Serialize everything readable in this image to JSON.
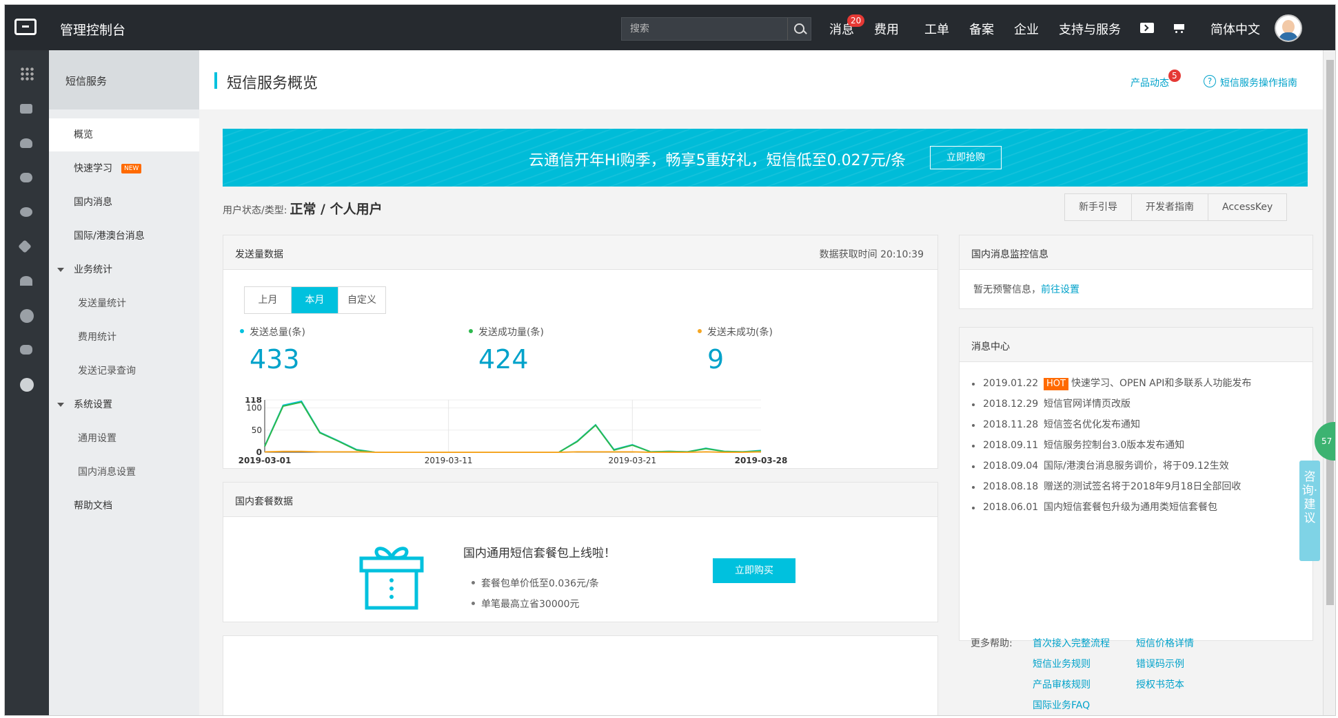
{
  "topbar": {
    "console_title": "管理控制台",
    "search_placeholder": "搜索",
    "nav": [
      "消息",
      "费用",
      "工单",
      "备案",
      "企业",
      "支持与服务"
    ],
    "message_count": "20",
    "language": "简体中文"
  },
  "subnav": {
    "header": "短信服务",
    "items": [
      "概览",
      "快速学习",
      "国内消息",
      "国际/港澳台消息",
      "业务统计",
      "发送量统计",
      "费用统计",
      "发送记录查询",
      "系统设置",
      "通用设置",
      "国内消息设置",
      "帮助文档"
    ],
    "new_badge": "NEW"
  },
  "page": {
    "title": "短信服务概览",
    "product_news": "产品动态",
    "product_news_count": "5",
    "guide_link": "短信服务操作指南",
    "help_mark": "?"
  },
  "banner": {
    "text": "云通信开年Hi购季，畅享5重好礼，短信低至0.027元/条",
    "button": "立即抢购"
  },
  "user_status": {
    "label": "用户状态/类型:",
    "value": "正常 / 个人用户"
  },
  "quick_buttons": [
    "新手引导",
    "开发者指南",
    "AccessKey"
  ],
  "send_card": {
    "title": "发送量数据",
    "fetch_time": "数据获取时间 20:10:39",
    "tabs": [
      "上月",
      "本月",
      "自定义"
    ],
    "active_tab": "本月",
    "stats": [
      {
        "label": "发送总量(条)",
        "value": "433",
        "color": "#00c1de"
      },
      {
        "label": "发送成功量(条)",
        "value": "424",
        "color": "#2db84d"
      },
      {
        "label": "发送未成功(条)",
        "value": "9",
        "color": "#f5a623"
      }
    ]
  },
  "chart_data": {
    "type": "line",
    "x_labels": [
      "2019-03-01",
      "2019-03-11",
      "2019-03-21",
      "2019-03-28"
    ],
    "x": [
      1,
      2,
      3,
      4,
      5,
      6,
      7,
      8,
      9,
      10,
      11,
      12,
      13,
      14,
      15,
      16,
      17,
      18,
      19,
      20,
      21,
      22,
      23,
      24,
      25,
      26,
      27,
      28
    ],
    "ylim": [
      0,
      118
    ],
    "yticks": [
      0,
      50,
      100,
      118
    ],
    "series": [
      {
        "color": "#00c1de",
        "values": [
          14,
          106,
          115,
          45,
          26,
          6,
          0,
          0,
          0,
          0,
          0,
          0,
          0,
          0,
          0,
          0,
          0,
          25,
          62,
          6,
          17,
          1,
          2,
          1,
          9,
          2,
          1,
          4
        ]
      },
      {
        "color": "#2db84d",
        "values": [
          13,
          104,
          113,
          44,
          25,
          5,
          0,
          0,
          0,
          0,
          0,
          0,
          0,
          0,
          0,
          0,
          0,
          24,
          61,
          5,
          16,
          1,
          2,
          1,
          8,
          2,
          1,
          3
        ]
      },
      {
        "color": "#f5a623",
        "values": [
          1,
          2,
          2,
          1,
          1,
          1,
          0,
          0,
          0,
          0,
          0,
          0,
          0,
          0,
          0,
          0,
          0,
          1,
          1,
          1,
          1,
          0,
          0,
          0,
          1,
          0,
          0,
          1
        ]
      }
    ]
  },
  "package_card": {
    "title": "国内套餐数据",
    "headline": "国内通用短信套餐包上线啦！",
    "points": [
      "套餐包单价低至0.036元/条",
      "单笔最高立省30000元"
    ],
    "button": "立即购买"
  },
  "monitor_card": {
    "title": "国内消息监控信息",
    "text": "暂无预警信息，",
    "link": "前往设置"
  },
  "message_center": {
    "title": "消息中心",
    "hot_label": "HOT",
    "items": [
      {
        "date": "2019.01.22",
        "text": "快速学习、OPEN API和多联系人功能发布"
      },
      {
        "date": "2018.12.29",
        "text": "短信官网详情页改版"
      },
      {
        "date": "2018.11.28",
        "text": "短信签名优化发布通知"
      },
      {
        "date": "2018.09.11",
        "text": "短信服务控制台3.0版本发布通知"
      },
      {
        "date": "2018.09.04",
        "text": "国际/港澳台消息服务调价，将于09.12生效"
      },
      {
        "date": "2018.08.18",
        "text": "赠送的测试签名将于2018年9月18日全部回收"
      },
      {
        "date": "2018.06.01",
        "text": "国内短信套餐包升级为通用类短信套餐包"
      }
    ],
    "more_help_label": "更多帮助:",
    "help_links": [
      "首次接入完整流程",
      "短信价格详情",
      "短信业务规则",
      "错误码示例",
      "产品审核规则",
      "授权书范本",
      "国际业务FAQ"
    ]
  },
  "side_widget": {
    "text": "咨询·建议",
    "bubble": "57"
  }
}
